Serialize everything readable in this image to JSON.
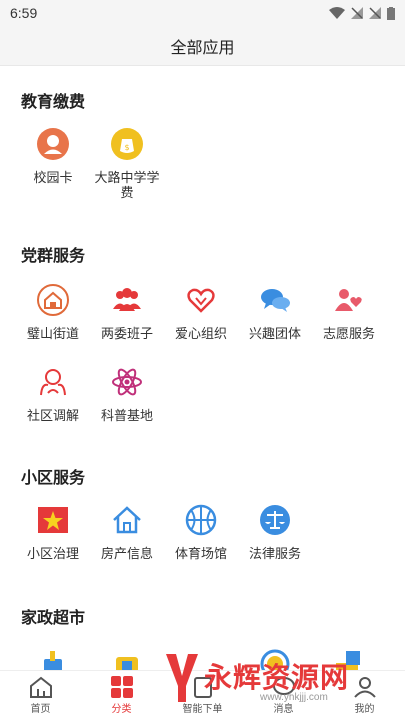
{
  "status_bar": {
    "time": "6:59"
  },
  "header": {
    "title": "全部应用"
  },
  "sections": [
    {
      "title": "教育缴费",
      "items": [
        {
          "label": "校园卡",
          "icon": "avatar-icon",
          "color": "#e8744a"
        },
        {
          "label": "大路中学学费",
          "icon": "money-bag-icon",
          "color": "#f0c020"
        }
      ]
    },
    {
      "title": "党群服务",
      "items": [
        {
          "label": "璧山街道",
          "icon": "house-icon",
          "color": "#e06a3a"
        },
        {
          "label": "两委班子",
          "icon": "group-icon",
          "color": "#e5393a"
        },
        {
          "label": "爱心组织",
          "icon": "heart-hands-icon",
          "color": "#e5393a"
        },
        {
          "label": "兴趣团体",
          "icon": "chat-bubbles-icon",
          "color": "#3a8de0"
        },
        {
          "label": "志愿服务",
          "icon": "volunteer-icon",
          "color": "#e85a6a"
        },
        {
          "label": "社区调解",
          "icon": "mediation-icon",
          "color": "#e5393a"
        },
        {
          "label": "科普基地",
          "icon": "atom-icon",
          "color": "#c0307a"
        }
      ]
    },
    {
      "title": "小区服务",
      "items": [
        {
          "label": "小区治理",
          "icon": "flag-icon",
          "color": "#e5393a"
        },
        {
          "label": "房产信息",
          "icon": "home-outline-icon",
          "color": "#3a8de0"
        },
        {
          "label": "体育场馆",
          "icon": "basketball-icon",
          "color": "#3a8de0"
        },
        {
          "label": "法律服务",
          "icon": "scales-icon",
          "color": "#3a8de0"
        }
      ]
    },
    {
      "title": "家政超市",
      "items": []
    }
  ],
  "tabbar": [
    {
      "label": "首页",
      "icon": "home-tab-icon",
      "active": false
    },
    {
      "label": "分类",
      "icon": "category-tab-icon",
      "active": true
    },
    {
      "label": "智能下单",
      "icon": "order-tab-icon",
      "active": false
    },
    {
      "label": "消息",
      "icon": "message-tab-icon",
      "active": false
    },
    {
      "label": "我的",
      "icon": "profile-tab-icon",
      "active": false
    }
  ],
  "watermark": {
    "text": "永辉资源网",
    "url": "www.yhkjjj.com"
  }
}
